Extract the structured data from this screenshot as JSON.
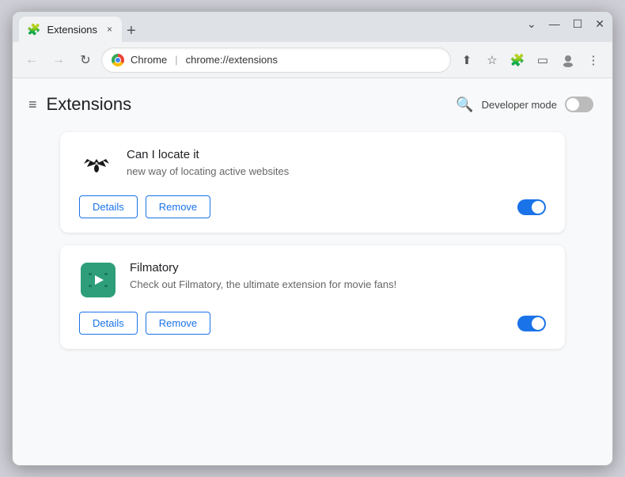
{
  "window": {
    "title": "Extensions",
    "tab_label": "Extensions",
    "tab_close": "×",
    "tab_new": "+",
    "controls": {
      "minimize": "—",
      "maximize": "☐",
      "close": "✕",
      "chevron": "⌄"
    }
  },
  "addressbar": {
    "back": "←",
    "forward": "→",
    "reload": "↻",
    "chrome_label": "Chrome",
    "url": "chrome://extensions",
    "separator": "|"
  },
  "toolbar": {
    "share": "⬆",
    "bookmark": "☆",
    "extensions": "⧉",
    "sidebar": "▭",
    "profile": "◯",
    "menu": "⋮"
  },
  "page": {
    "title": "Extensions",
    "hamburger": "≡",
    "search_title": "Search",
    "developer_mode_label": "Developer mode"
  },
  "extensions": [
    {
      "id": "can-i-locate-it",
      "name": "Can I locate it",
      "description": "new way of locating active websites",
      "enabled": true,
      "details_label": "Details",
      "remove_label": "Remove"
    },
    {
      "id": "filmatory",
      "name": "Filmatory",
      "description": "Check out Filmatory, the ultimate extension for movie fans!",
      "enabled": true,
      "details_label": "Details",
      "remove_label": "Remove"
    }
  ]
}
